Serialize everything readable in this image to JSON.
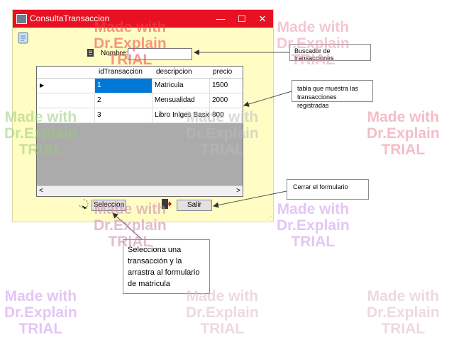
{
  "window": {
    "title": "ConsultaTransaccion",
    "minimize_glyph": "—",
    "maximize_glyph": "☐",
    "close_glyph": "✕"
  },
  "form": {
    "search_label": "Nombre:",
    "search_value": ""
  },
  "grid": {
    "columns": [
      "idTransaccion",
      "descripcion",
      "precio"
    ],
    "rows": [
      {
        "id": "1",
        "descripcion": "Matricula",
        "precio": "1500"
      },
      {
        "id": "2",
        "descripcion": "Mensualidad",
        "precio": "2000"
      },
      {
        "id": "3",
        "descripcion": "Libro Inlges Basico",
        "precio": "800"
      }
    ],
    "scroll_left": "<",
    "scroll_right": ">"
  },
  "buttons": {
    "select": "Seleccion",
    "exit": "Salir"
  },
  "callouts": {
    "search": "Buscador de transacciones",
    "table": "tabla que muestra las transacciones registradas",
    "close": "Cerrar el formulario",
    "select": "Selecciona una transacción y la arrastra al formulario de matricula"
  },
  "watermark": "Made with\nDr.Explain\nTRIAL"
}
